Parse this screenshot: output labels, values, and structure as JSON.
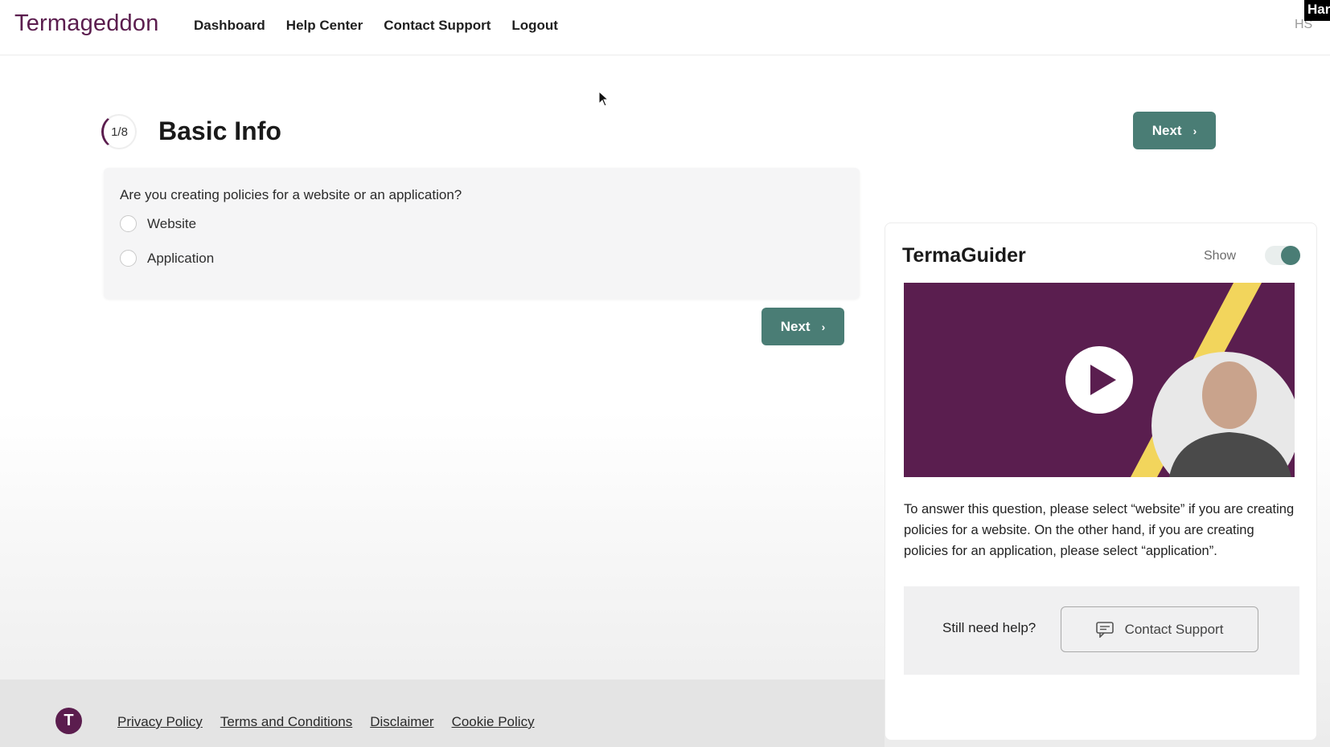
{
  "header": {
    "logo": "Termageddon",
    "nav": [
      "Dashboard",
      "Help Center",
      "Contact Support",
      "Logout"
    ],
    "avatar": "HS",
    "corner_tag": "Har"
  },
  "step": {
    "progress": "1/8",
    "title": "Basic Info",
    "next_label": "Next"
  },
  "question": {
    "text": "Are you creating policies for a website or an application?",
    "options": [
      "Website",
      "Application"
    ],
    "selected": null
  },
  "guider": {
    "title": "TermaGuider",
    "show_label": "Show",
    "show_enabled": true,
    "description": "To answer this question, please select “website” if you are creating policies for a website. On the other hand, if you are creating policies for an application, please select “application”.",
    "help_question": "Still need help?",
    "contact_label": "Contact Support"
  },
  "footer": {
    "logo_letter": "T",
    "links": [
      "Privacy Policy",
      "Terms and Conditions",
      "Disclaimer",
      "Cookie Policy"
    ]
  },
  "colors": {
    "brand": "#5b1d4e",
    "accent": "#4a7d75",
    "video_bg": "#5a1e4f",
    "video_stripe": "#f2d55c"
  },
  "icons": [
    "play-icon",
    "chat-icon",
    "chevron-right-icon",
    "mouse-cursor-icon"
  ]
}
